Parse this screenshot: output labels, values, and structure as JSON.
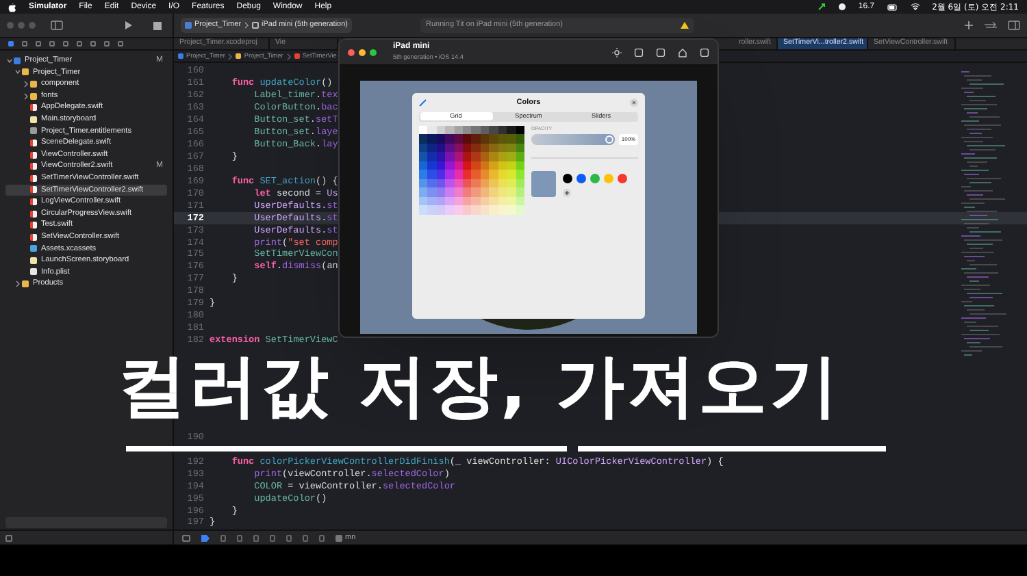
{
  "menu_bar": {
    "app": "Simulator",
    "items": [
      "File",
      "Edit",
      "Device",
      "I/O",
      "Features",
      "Debug",
      "Window",
      "Help"
    ],
    "status_text": "16.7",
    "clock": "2월 6일 (토) 오전 2:11"
  },
  "toolbar": {
    "scheme": "Project_Timer",
    "destination": "iPad mini (5th generation)",
    "status": "Running Tit on iPad mini (5th generation)"
  },
  "navigator": [
    {
      "label": "Project_Timer",
      "kind": "project",
      "badge": "M",
      "expanded": true,
      "selected": false,
      "children": [
        {
          "label": "Project_Timer",
          "kind": "folder",
          "expanded": true,
          "selected": false,
          "children": [
            {
              "label": "component",
              "kind": "folder",
              "expanded": false,
              "selected": false
            },
            {
              "label": "fonts",
              "kind": "folder",
              "expanded": false,
              "selected": false
            },
            {
              "label": "AppDelegate.swift",
              "kind": "swift",
              "selected": false
            },
            {
              "label": "Main.storyboard",
              "kind": "storyboard",
              "selected": false
            },
            {
              "label": "Project_Timer.entitlements",
              "kind": "entitlements",
              "selected": false
            },
            {
              "label": "SceneDelegate.swift",
              "kind": "swift",
              "selected": false
            },
            {
              "label": "ViewController.swift",
              "kind": "swift",
              "selected": false
            },
            {
              "label": "ViewController2.swift",
              "kind": "swift",
              "badge": "M",
              "selected": false
            },
            {
              "label": "SetTimerViewController.swift",
              "kind": "swift",
              "selected": false
            },
            {
              "label": "SetTimerViewController2.swift",
              "kind": "swift",
              "selected": true
            },
            {
              "label": "LogViewController.swift",
              "kind": "swift",
              "selected": false
            },
            {
              "label": "CircularProgressView.swift",
              "kind": "swift",
              "selected": false
            },
            {
              "label": "Test.swift",
              "kind": "swift",
              "selected": false
            },
            {
              "label": "SetViewController.swift",
              "kind": "swift",
              "selected": false
            },
            {
              "label": "Assets.xcassets",
              "kind": "assets",
              "selected": false
            },
            {
              "label": "LaunchScreen.storyboard",
              "kind": "storyboard",
              "selected": false
            },
            {
              "label": "Info.plist",
              "kind": "plist",
              "selected": false
            }
          ]
        },
        {
          "label": "Products",
          "kind": "folder",
          "expanded": false,
          "selected": false
        }
      ]
    }
  ],
  "tabs": [
    {
      "label": "Project_Timer.xcodeproj",
      "selected": false
    },
    {
      "label": "Vie",
      "selected": false
    },
    {
      "label": "roller.swift",
      "selected": false
    },
    {
      "label": "SetTimerVi...troller2.swift",
      "selected": true
    },
    {
      "label": "SetViewController.swift",
      "selected": false
    }
  ],
  "jump_bar": [
    "Project_Timer",
    "Project_Timer",
    "SetTimerVie"
  ],
  "code": [
    {
      "n": "160",
      "current": false
    },
    {
      "n": "161",
      "current": false,
      "segs": [
        {
          "t": "    func ",
          "kind": "kw"
        },
        {
          "t": "updateColor",
          "kind": "decl"
        },
        {
          "t": "() ",
          "kind": "plain"
        }
      ]
    },
    {
      "n": "162",
      "current": false,
      "segs": [
        {
          "t": "        Label_timer",
          "kind": "fn"
        },
        {
          "t": ".",
          "kind": "plain"
        },
        {
          "t": "tex",
          "kind": "prop"
        }
      ]
    },
    {
      "n": "163",
      "current": false,
      "segs": [
        {
          "t": "        ColorButton",
          "kind": "fn"
        },
        {
          "t": ".",
          "kind": "plain"
        },
        {
          "t": "bac",
          "kind": "prop"
        }
      ]
    },
    {
      "n": "164",
      "current": false,
      "segs": [
        {
          "t": "        Button_set",
          "kind": "fn"
        },
        {
          "t": ".",
          "kind": "plain"
        },
        {
          "t": "setT",
          "kind": "prop"
        }
      ]
    },
    {
      "n": "165",
      "current": false,
      "segs": [
        {
          "t": "        Button_set",
          "kind": "fn"
        },
        {
          "t": ".",
          "kind": "plain"
        },
        {
          "t": "laye",
          "kind": "prop"
        }
      ]
    },
    {
      "n": "166",
      "current": false,
      "segs": [
        {
          "t": "        Button_Back",
          "kind": "fn"
        },
        {
          "t": ".",
          "kind": "plain"
        },
        {
          "t": "lay",
          "kind": "prop"
        }
      ]
    },
    {
      "n": "167",
      "current": false,
      "segs": [
        {
          "t": "    }",
          "kind": "plain"
        }
      ]
    },
    {
      "n": "168",
      "current": false
    },
    {
      "n": "169",
      "current": false,
      "segs": [
        {
          "t": "    func ",
          "kind": "kw"
        },
        {
          "t": "SET_action",
          "kind": "decl"
        },
        {
          "t": "() {",
          "kind": "plain"
        }
      ]
    },
    {
      "n": "170",
      "current": false,
      "segs": [
        {
          "t": "        let ",
          "kind": "kw"
        },
        {
          "t": "second = ",
          "kind": "plain"
        },
        {
          "t": "Us",
          "kind": "ty"
        }
      ]
    },
    {
      "n": "171",
      "current": false,
      "segs": [
        {
          "t": "        UserDefaults",
          "kind": "ty"
        },
        {
          "t": ".",
          "kind": "plain"
        },
        {
          "t": "st",
          "kind": "prop"
        }
      ]
    },
    {
      "n": "172",
      "current": true,
      "segs": [
        {
          "t": "        UserDefaults",
          "kind": "ty"
        },
        {
          "t": ".",
          "kind": "plain"
        },
        {
          "t": "st",
          "kind": "prop"
        }
      ]
    },
    {
      "n": "173",
      "current": false,
      "segs": [
        {
          "t": "        UserDefaults",
          "kind": "ty"
        },
        {
          "t": ".",
          "kind": "plain"
        },
        {
          "t": "st",
          "kind": "prop"
        }
      ]
    },
    {
      "n": "174",
      "current": false,
      "segs": [
        {
          "t": "        print",
          "kind": "prop"
        },
        {
          "t": "(",
          "kind": "plain"
        },
        {
          "t": "\"set comp",
          "kind": "str"
        }
      ]
    },
    {
      "n": "175",
      "current": false,
      "segs": [
        {
          "t": "        SetTimerViewCon",
          "kind": "fn"
        }
      ]
    },
    {
      "n": "176",
      "current": false,
      "segs": [
        {
          "t": "        self",
          "kind": "kw"
        },
        {
          "t": ".",
          "kind": "plain"
        },
        {
          "t": "dismiss",
          "kind": "prop"
        },
        {
          "t": "(an",
          "kind": "plain"
        }
      ]
    },
    {
      "n": "177",
      "current": false,
      "segs": [
        {
          "t": "    }",
          "kind": "plain"
        }
      ]
    },
    {
      "n": "178",
      "current": false
    },
    {
      "n": "179",
      "current": false,
      "segs": [
        {
          "t": "}",
          "kind": "plain"
        }
      ]
    },
    {
      "n": "180",
      "current": false
    },
    {
      "n": "181",
      "current": false
    },
    {
      "n": "182",
      "current": false,
      "segs": [
        {
          "t": "extension ",
          "kind": "kw"
        },
        {
          "t": "SetTimerViewC",
          "kind": "fn"
        }
      ]
    },
    {
      "current": false
    },
    {
      "current": false
    },
    {
      "current": false
    },
    {
      "current": false
    },
    {
      "current": false
    },
    {
      "current": false
    },
    {
      "current": false
    },
    {
      "n": "190",
      "current": false
    },
    {
      "current": false
    },
    {
      "n": "192",
      "current": false,
      "segs": [
        {
          "t": "    func ",
          "kind": "kw"
        },
        {
          "t": "colorPickerViewControllerDidFinish",
          "kind": "decl"
        },
        {
          "t": "(_ viewController: ",
          "kind": "plain"
        },
        {
          "t": "UIColorPickerViewController",
          "kind": "ty"
        },
        {
          "t": ") {",
          "kind": "plain"
        }
      ]
    },
    {
      "n": "193",
      "current": false,
      "segs": [
        {
          "t": "        print",
          "kind": "prop"
        },
        {
          "t": "(viewController.",
          "kind": "plain"
        },
        {
          "t": "selectedColor",
          "kind": "prop"
        },
        {
          "t": ")",
          "kind": "plain"
        }
      ]
    },
    {
      "n": "194",
      "current": false,
      "segs": [
        {
          "t": "        COLOR",
          "kind": "fn"
        },
        {
          "t": " = viewController.",
          "kind": "plain"
        },
        {
          "t": "selectedColor",
          "kind": "prop"
        }
      ]
    },
    {
      "n": "195",
      "current": false,
      "segs": [
        {
          "t": "        updateColor",
          "kind": "fn"
        },
        {
          "t": "()",
          "kind": "plain"
        }
      ]
    },
    {
      "n": "196",
      "current": false,
      "segs": [
        {
          "t": "    }",
          "kind": "plain"
        }
      ]
    },
    {
      "n": "197",
      "current": false,
      "segs": [
        {
          "t": "}",
          "kind": "plain"
        }
      ]
    }
  ],
  "debug_bar": {
    "target": "mn"
  },
  "simulator": {
    "title": "iPad mini",
    "subtitle": "5th generation • iOS 14.4",
    "color_picker": {
      "title": "Colors",
      "segments": [
        {
          "label": "Grid",
          "selected": true
        },
        {
          "label": "Spectrum",
          "selected": false
        },
        {
          "label": "Sliders",
          "selected": false
        }
      ],
      "opacity_label": "OPACITY",
      "opacity": {
        "level": 1
      },
      "opacity_value": "100%",
      "swatches": [
        {
          "color": "#000000"
        },
        {
          "color": "#0a5cf5"
        },
        {
          "color": "#2fb84a"
        },
        {
          "color": "#fcc30a"
        },
        {
          "color": "#f23a30"
        }
      ]
    }
  },
  "caption": "컬러값 저장, 가져오기"
}
